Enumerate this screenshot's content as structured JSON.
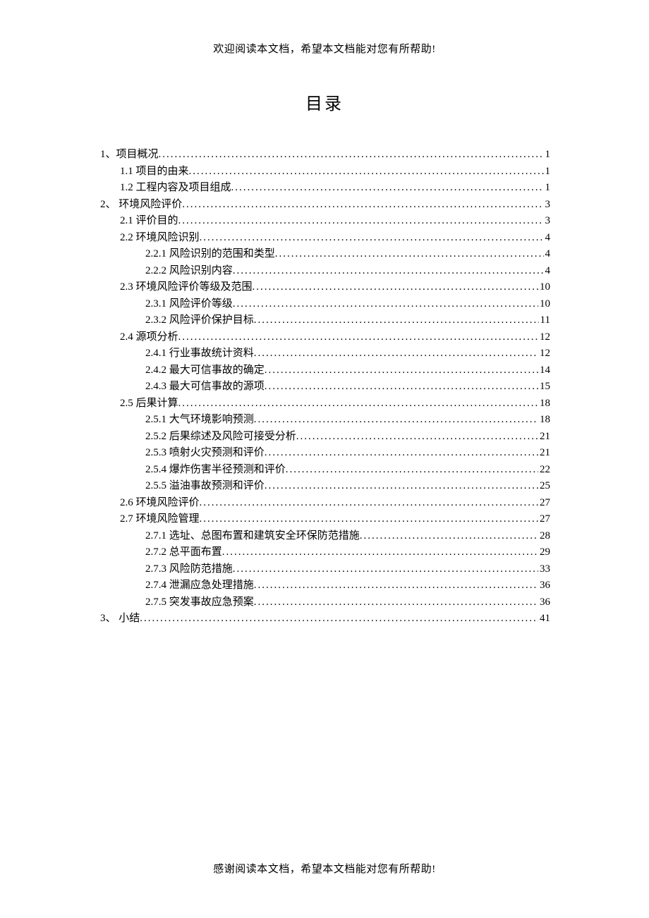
{
  "header": "欢迎阅读本文档，希望本文档能对您有所帮助!",
  "title": "目录",
  "footer": "感谢阅读本文档，希望本文档能对您有所帮助!",
  "toc": [
    {
      "level": 1,
      "label": "1、项目概况",
      "page": "1"
    },
    {
      "level": 2,
      "label": "1.1 项目的由来",
      "page": "1"
    },
    {
      "level": 2,
      "label": "1.2 工程内容及项目组成",
      "page": "1"
    },
    {
      "level": 1,
      "label": "2、 环境风险评价",
      "page": "3"
    },
    {
      "level": 2,
      "label": "2.1 评价目的",
      "page": "3"
    },
    {
      "level": 2,
      "label": "2.2 环境风险识别",
      "page": "4"
    },
    {
      "level": 3,
      "label": "2.2.1 风险识别的范围和类型",
      "page": "4"
    },
    {
      "level": 3,
      "label": "2.2.2 风险识别内容",
      "page": "4"
    },
    {
      "level": 2,
      "label": "2.3 环境风险评价等级及范围",
      "page": "10"
    },
    {
      "level": 3,
      "label": "2.3.1 风险评价等级",
      "page": "10"
    },
    {
      "level": 3,
      "label": "2.3.2 风险评价保护目标",
      "page": "11"
    },
    {
      "level": 2,
      "label": "2.4 源项分析",
      "page": "12"
    },
    {
      "level": 3,
      "label": "2.4.1 行业事故统计资料",
      "page": "12"
    },
    {
      "level": 3,
      "label": "2.4.2 最大可信事故的确定",
      "page": "14"
    },
    {
      "level": 3,
      "label": "2.4.3 最大可信事故的源项",
      "page": "15"
    },
    {
      "level": 2,
      "label": "2.5 后果计算",
      "page": "18"
    },
    {
      "level": 3,
      "label": "2.5.1 大气环境影响预测",
      "page": "18"
    },
    {
      "level": 3,
      "label": "2.5.2 后果综述及风险可接受分析",
      "page": "21"
    },
    {
      "level": 3,
      "label": "2.5.3 喷射火灾预测和评价",
      "page": "21"
    },
    {
      "level": 3,
      "label": "2.5.4 爆炸伤害半径预测和评价",
      "page": "22"
    },
    {
      "level": 3,
      "label": "2.5.5 溢油事故预测和评价",
      "page": "25"
    },
    {
      "level": 2,
      "label": "2.6 环境风险评价",
      "page": "27"
    },
    {
      "level": 2,
      "label": "2.7 环境风险管理",
      "page": "27"
    },
    {
      "level": 3,
      "label": "2.7.1 选址、总图布置和建筑安全环保防范措施",
      "page": "28"
    },
    {
      "level": 3,
      "label": "2.7.2 总平面布置",
      "page": "29"
    },
    {
      "level": 3,
      "label": "2.7.3 风险防范措施",
      "page": "33"
    },
    {
      "level": 3,
      "label": "2.7.4 泄漏应急处理措施",
      "page": "36"
    },
    {
      "level": 3,
      "label": "2.7.5 突发事故应急预案",
      "page": "36"
    },
    {
      "level": 1,
      "label": "3、 小结",
      "page": "41"
    }
  ]
}
